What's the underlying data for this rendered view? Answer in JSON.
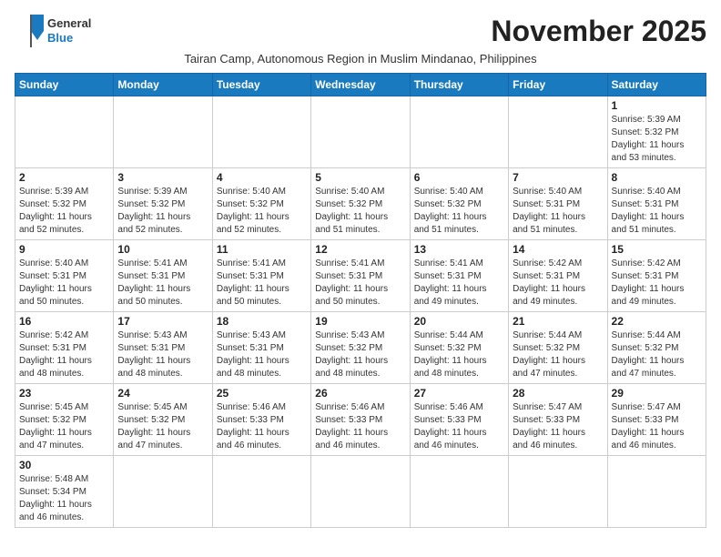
{
  "logo": {
    "line1": "General",
    "line2": "Blue"
  },
  "title": "November 2025",
  "subtitle": "Tairan Camp, Autonomous Region in Muslim Mindanao, Philippines",
  "days_of_week": [
    "Sunday",
    "Monday",
    "Tuesday",
    "Wednesday",
    "Thursday",
    "Friday",
    "Saturday"
  ],
  "weeks": [
    [
      {
        "day": "",
        "info": ""
      },
      {
        "day": "",
        "info": ""
      },
      {
        "day": "",
        "info": ""
      },
      {
        "day": "",
        "info": ""
      },
      {
        "day": "",
        "info": ""
      },
      {
        "day": "",
        "info": ""
      },
      {
        "day": "1",
        "info": "Sunrise: 5:39 AM\nSunset: 5:32 PM\nDaylight: 11 hours\nand 53 minutes."
      }
    ],
    [
      {
        "day": "2",
        "info": "Sunrise: 5:39 AM\nSunset: 5:32 PM\nDaylight: 11 hours\nand 52 minutes."
      },
      {
        "day": "3",
        "info": "Sunrise: 5:39 AM\nSunset: 5:32 PM\nDaylight: 11 hours\nand 52 minutes."
      },
      {
        "day": "4",
        "info": "Sunrise: 5:40 AM\nSunset: 5:32 PM\nDaylight: 11 hours\nand 52 minutes."
      },
      {
        "day": "5",
        "info": "Sunrise: 5:40 AM\nSunset: 5:32 PM\nDaylight: 11 hours\nand 51 minutes."
      },
      {
        "day": "6",
        "info": "Sunrise: 5:40 AM\nSunset: 5:32 PM\nDaylight: 11 hours\nand 51 minutes."
      },
      {
        "day": "7",
        "info": "Sunrise: 5:40 AM\nSunset: 5:31 PM\nDaylight: 11 hours\nand 51 minutes."
      },
      {
        "day": "8",
        "info": "Sunrise: 5:40 AM\nSunset: 5:31 PM\nDaylight: 11 hours\nand 51 minutes."
      }
    ],
    [
      {
        "day": "9",
        "info": "Sunrise: 5:40 AM\nSunset: 5:31 PM\nDaylight: 11 hours\nand 50 minutes."
      },
      {
        "day": "10",
        "info": "Sunrise: 5:41 AM\nSunset: 5:31 PM\nDaylight: 11 hours\nand 50 minutes."
      },
      {
        "day": "11",
        "info": "Sunrise: 5:41 AM\nSunset: 5:31 PM\nDaylight: 11 hours\nand 50 minutes."
      },
      {
        "day": "12",
        "info": "Sunrise: 5:41 AM\nSunset: 5:31 PM\nDaylight: 11 hours\nand 50 minutes."
      },
      {
        "day": "13",
        "info": "Sunrise: 5:41 AM\nSunset: 5:31 PM\nDaylight: 11 hours\nand 49 minutes."
      },
      {
        "day": "14",
        "info": "Sunrise: 5:42 AM\nSunset: 5:31 PM\nDaylight: 11 hours\nand 49 minutes."
      },
      {
        "day": "15",
        "info": "Sunrise: 5:42 AM\nSunset: 5:31 PM\nDaylight: 11 hours\nand 49 minutes."
      }
    ],
    [
      {
        "day": "16",
        "info": "Sunrise: 5:42 AM\nSunset: 5:31 PM\nDaylight: 11 hours\nand 48 minutes."
      },
      {
        "day": "17",
        "info": "Sunrise: 5:43 AM\nSunset: 5:31 PM\nDaylight: 11 hours\nand 48 minutes."
      },
      {
        "day": "18",
        "info": "Sunrise: 5:43 AM\nSunset: 5:31 PM\nDaylight: 11 hours\nand 48 minutes."
      },
      {
        "day": "19",
        "info": "Sunrise: 5:43 AM\nSunset: 5:32 PM\nDaylight: 11 hours\nand 48 minutes."
      },
      {
        "day": "20",
        "info": "Sunrise: 5:44 AM\nSunset: 5:32 PM\nDaylight: 11 hours\nand 48 minutes."
      },
      {
        "day": "21",
        "info": "Sunrise: 5:44 AM\nSunset: 5:32 PM\nDaylight: 11 hours\nand 47 minutes."
      },
      {
        "day": "22",
        "info": "Sunrise: 5:44 AM\nSunset: 5:32 PM\nDaylight: 11 hours\nand 47 minutes."
      }
    ],
    [
      {
        "day": "23",
        "info": "Sunrise: 5:45 AM\nSunset: 5:32 PM\nDaylight: 11 hours\nand 47 minutes."
      },
      {
        "day": "24",
        "info": "Sunrise: 5:45 AM\nSunset: 5:32 PM\nDaylight: 11 hours\nand 47 minutes."
      },
      {
        "day": "25",
        "info": "Sunrise: 5:46 AM\nSunset: 5:33 PM\nDaylight: 11 hours\nand 46 minutes."
      },
      {
        "day": "26",
        "info": "Sunrise: 5:46 AM\nSunset: 5:33 PM\nDaylight: 11 hours\nand 46 minutes."
      },
      {
        "day": "27",
        "info": "Sunrise: 5:46 AM\nSunset: 5:33 PM\nDaylight: 11 hours\nand 46 minutes."
      },
      {
        "day": "28",
        "info": "Sunrise: 5:47 AM\nSunset: 5:33 PM\nDaylight: 11 hours\nand 46 minutes."
      },
      {
        "day": "29",
        "info": "Sunrise: 5:47 AM\nSunset: 5:33 PM\nDaylight: 11 hours\nand 46 minutes."
      }
    ],
    [
      {
        "day": "30",
        "info": "Sunrise: 5:48 AM\nSunset: 5:34 PM\nDaylight: 11 hours\nand 46 minutes."
      },
      {
        "day": "",
        "info": ""
      },
      {
        "day": "",
        "info": ""
      },
      {
        "day": "",
        "info": ""
      },
      {
        "day": "",
        "info": ""
      },
      {
        "day": "",
        "info": ""
      },
      {
        "day": "",
        "info": ""
      }
    ]
  ]
}
